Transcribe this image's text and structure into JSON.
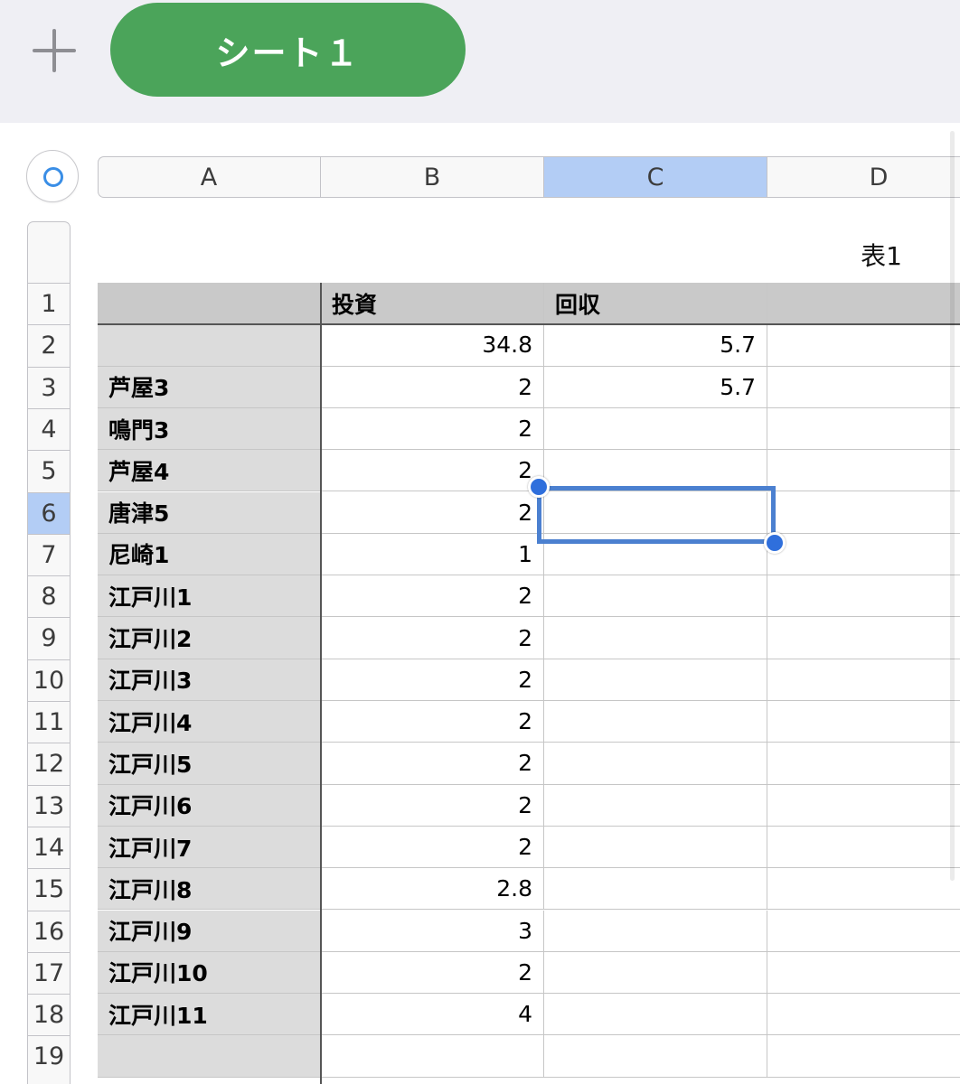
{
  "toolbar": {
    "add_icon": "plus-icon",
    "sheet_tab": "シート１"
  },
  "selector_icon": "circle-icon",
  "columns": [
    "A",
    "B",
    "C",
    "D"
  ],
  "selected_column": "C",
  "rows": [
    "1",
    "2",
    "3",
    "4",
    "5",
    "6",
    "7",
    "8",
    "9",
    "10",
    "11",
    "12",
    "13",
    "14",
    "15",
    "16",
    "17",
    "18",
    "19"
  ],
  "selected_row": "6",
  "table_name": "表1",
  "table": {
    "headers": [
      "",
      "投資",
      "回収",
      ""
    ],
    "rows": [
      [
        "",
        "34.8",
        "5.7",
        ""
      ],
      [
        "芦屋3",
        "2",
        "5.7",
        ""
      ],
      [
        "鳴門3",
        "2",
        "",
        ""
      ],
      [
        "芦屋4",
        "2",
        "",
        ""
      ],
      [
        "唐津5",
        "2",
        "",
        ""
      ],
      [
        "尼崎1",
        "1",
        "",
        ""
      ],
      [
        "江戸川1",
        "2",
        "",
        ""
      ],
      [
        "江戸川2",
        "2",
        "",
        ""
      ],
      [
        "江戸川3",
        "2",
        "",
        ""
      ],
      [
        "江戸川4",
        "2",
        "",
        ""
      ],
      [
        "江戸川5",
        "2",
        "",
        ""
      ],
      [
        "江戸川6",
        "2",
        "",
        ""
      ],
      [
        "江戸川7",
        "2",
        "",
        ""
      ],
      [
        "江戸川8",
        "2.8",
        "",
        ""
      ],
      [
        "江戸川9",
        "3",
        "",
        ""
      ],
      [
        "江戸川10",
        "2",
        "",
        ""
      ],
      [
        "江戸川11",
        "4",
        "",
        ""
      ],
      [
        "",
        "",
        "",
        ""
      ]
    ]
  },
  "colors": {
    "tab_green": "#4ba45a",
    "selection_blue": "#4b80d0",
    "header_highlight": "#b3cdf5"
  }
}
